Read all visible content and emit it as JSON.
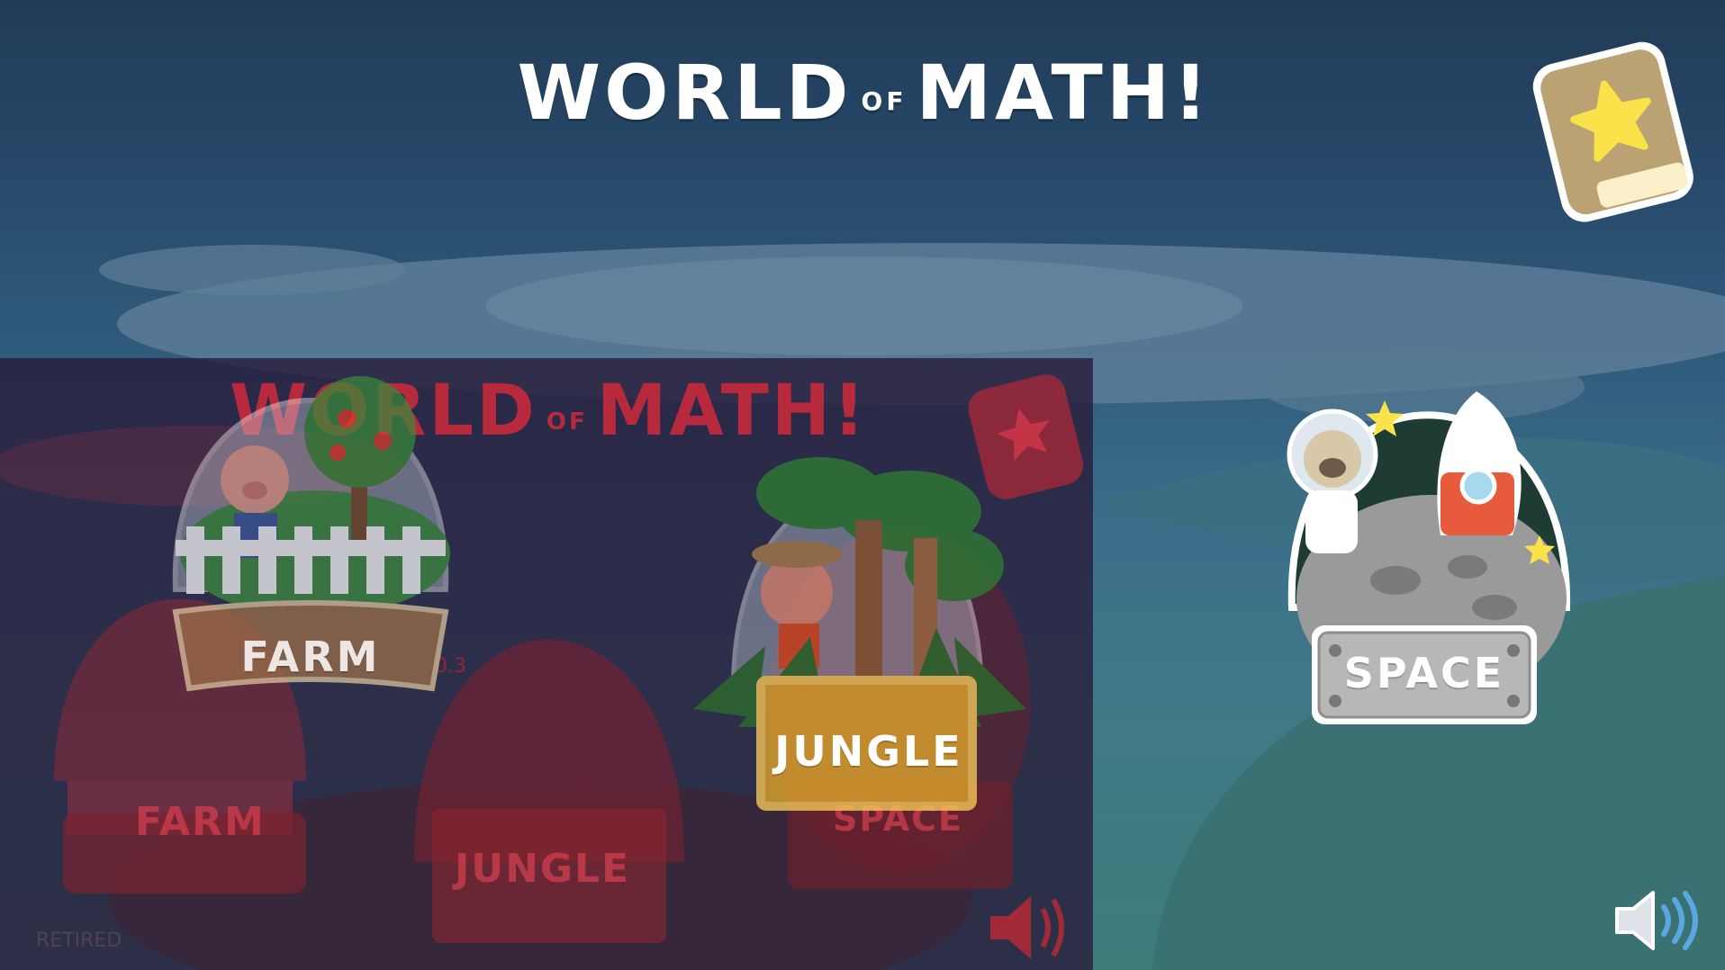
{
  "title": {
    "world": "WORLD",
    "of": "OF",
    "math": "MATH!"
  },
  "overlay": {
    "title": {
      "world": "WORLD",
      "of": "OF",
      "math": "MATH!"
    },
    "labels": {
      "farm_back": "FARM",
      "jungle_back": "JUNGLE",
      "space_back": "SPACE",
      "version": "0.3",
      "build": "RETIRED"
    }
  },
  "levels": {
    "farm": {
      "label": "FARM"
    },
    "jungle": {
      "label": "JUNGLE"
    },
    "space": {
      "label": "SPACE"
    }
  },
  "icons": {
    "sticker_book": "star-book-icon",
    "sound": "speaker-icon"
  },
  "colors": {
    "title": "#ffffff",
    "overlay_red": "#c7293b",
    "star_yellow": "#f9e24a",
    "book_tan": "#bba272"
  }
}
